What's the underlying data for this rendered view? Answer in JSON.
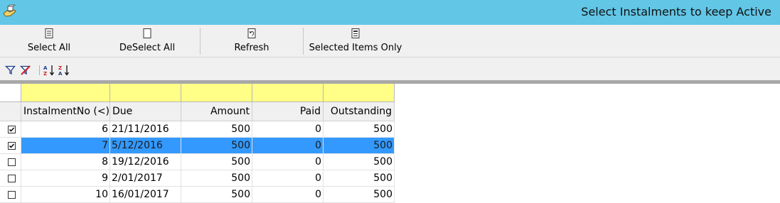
{
  "window": {
    "title": "Select Instalments to keep Active",
    "app_icon": "hand-with-box-icon"
  },
  "toolbar": {
    "buttons": [
      {
        "label": "Select All",
        "icon": "select-all-icon"
      },
      {
        "label": "DeSelect All",
        "icon": "deselect-all-icon"
      },
      {
        "label": "Refresh",
        "icon": "refresh-icon"
      },
      {
        "label": "Selected Items Only",
        "icon": "selected-items-icon"
      }
    ]
  },
  "filterbar": {
    "icons": [
      "filter-icon",
      "clear-filter-icon",
      "sort-ascending-icon",
      "sort-descending-icon"
    ]
  },
  "grid": {
    "columns": [
      "InstalmentNo (<)",
      "Due",
      "Amount",
      "Paid",
      "Outstanding"
    ],
    "filter_color": "#ffff88",
    "selection_color": "#3399ff",
    "rows": [
      {
        "checked": true,
        "selected": false,
        "no": "6",
        "due": "21/11/2016",
        "amount": "500",
        "paid": "0",
        "outstanding": "500"
      },
      {
        "checked": true,
        "selected": true,
        "no": "7",
        "due": "5/12/2016",
        "amount": "500",
        "paid": "0",
        "outstanding": "500"
      },
      {
        "checked": false,
        "selected": false,
        "no": "8",
        "due": "19/12/2016",
        "amount": "500",
        "paid": "0",
        "outstanding": "500"
      },
      {
        "checked": false,
        "selected": false,
        "no": "9",
        "due": "2/01/2017",
        "amount": "500",
        "paid": "0",
        "outstanding": "500"
      },
      {
        "checked": false,
        "selected": false,
        "no": "10",
        "due": "16/01/2017",
        "amount": "500",
        "paid": "0",
        "outstanding": "500"
      }
    ]
  }
}
